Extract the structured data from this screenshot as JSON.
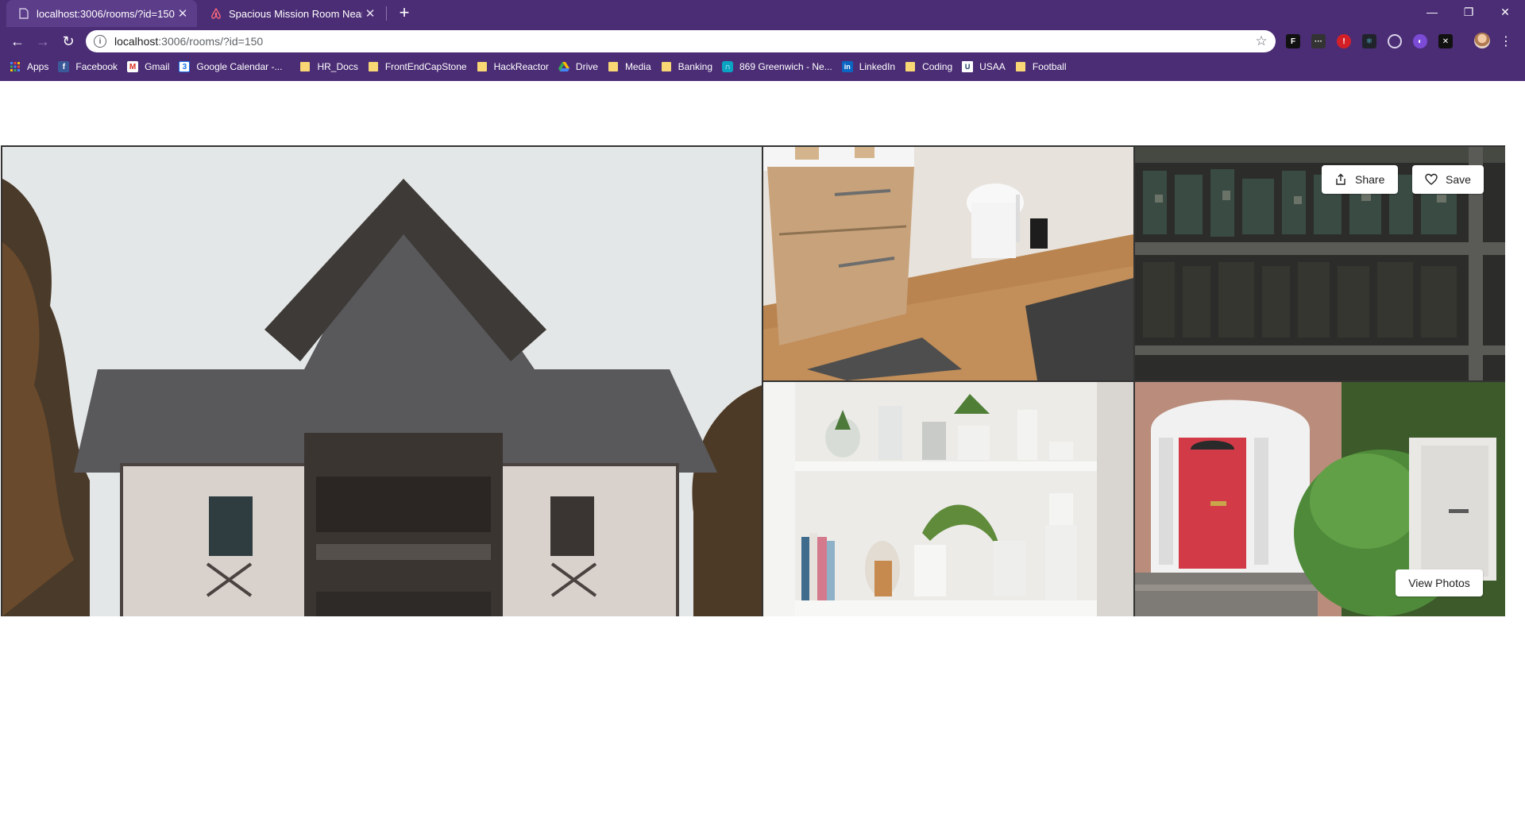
{
  "browser": {
    "tabs": [
      {
        "title": "localhost:3006/rooms/?id=150",
        "icon": "page-icon",
        "active": true
      },
      {
        "title": "Spacious Mission Room Near BAR",
        "icon": "airbnb-logo-icon",
        "active": false
      }
    ],
    "url": {
      "host": "localhost",
      "path": ":3006/rooms/?id=150"
    },
    "window_controls": {
      "minimize": "—",
      "restore": "❐",
      "close": "✕"
    },
    "bookmarks": [
      {
        "label": "Apps",
        "icon": "apps-grid-icon"
      },
      {
        "label": "Facebook",
        "icon": "facebook-icon"
      },
      {
        "label": "Gmail",
        "icon": "gmail-icon"
      },
      {
        "label": "Google Calendar -...",
        "icon": "calendar-icon"
      },
      {
        "label": "HR_Docs",
        "icon": "folder-icon"
      },
      {
        "label": "FrontEndCapStone",
        "icon": "folder-icon"
      },
      {
        "label": "HackReactor",
        "icon": "folder-icon"
      },
      {
        "label": "Drive",
        "icon": "drive-icon"
      },
      {
        "label": "Media",
        "icon": "folder-icon"
      },
      {
        "label": "Banking",
        "icon": "folder-icon"
      },
      {
        "label": "869 Greenwich - Ne...",
        "icon": "bookmark-site-icon"
      },
      {
        "label": "LinkedIn",
        "icon": "linkedin-icon"
      },
      {
        "label": "Coding",
        "icon": "folder-icon"
      },
      {
        "label": "USAA",
        "icon": "usaa-icon"
      },
      {
        "label": "Football",
        "icon": "folder-icon"
      }
    ],
    "colors": {
      "chrome": "#4b2d75",
      "active_tab": "#5c3d8a"
    }
  },
  "gallery": {
    "photos": [
      {
        "name": "house-exterior-photo"
      },
      {
        "name": "bathroom-photo"
      },
      {
        "name": "aerial-neighborhood-photo"
      },
      {
        "name": "shelf-decor-photo"
      },
      {
        "name": "front-doors-photo"
      }
    ],
    "share_label": "Share",
    "save_label": "Save",
    "view_photos_label": "View Photos"
  }
}
